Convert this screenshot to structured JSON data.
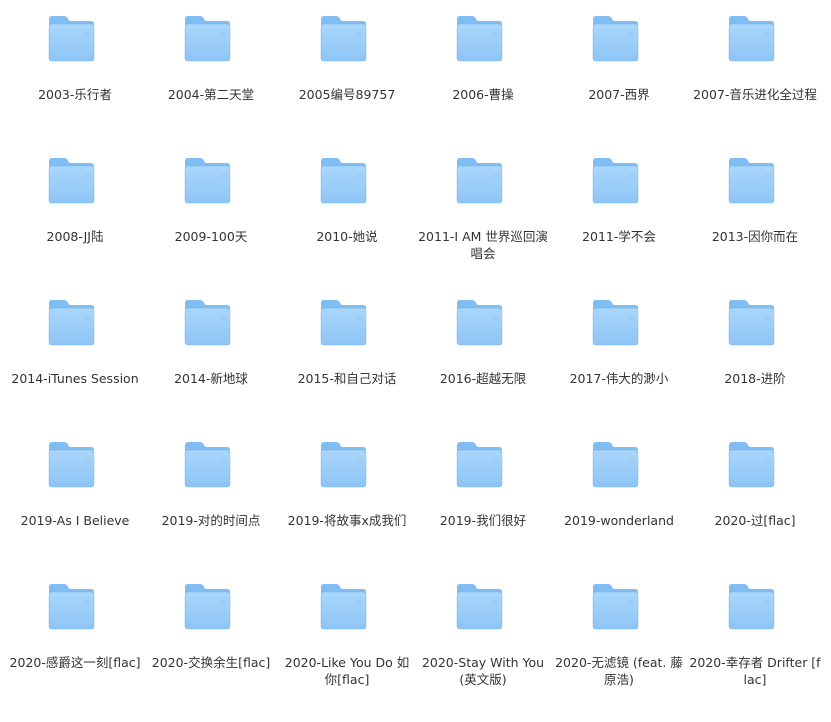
{
  "colors": {
    "folder_back": "#7fbdf3",
    "folder_front_top": "#a9d6fb",
    "folder_front_bottom": "#8ec5f6",
    "folder_edge": "#6aaee8",
    "label_text": "#333333"
  },
  "folder_icon": "folder-icon",
  "folders": [
    {
      "name": "2003-乐行者"
    },
    {
      "name": "2004-第二天堂"
    },
    {
      "name": "2005编号89757"
    },
    {
      "name": "2006-曹操"
    },
    {
      "name": "2007-西界"
    },
    {
      "name": "2007-音乐进化全过程"
    },
    {
      "name": "2008-JJ陆"
    },
    {
      "name": "2009-100天"
    },
    {
      "name": "2010-她说"
    },
    {
      "name": "2011-I AM 世界巡回演唱会"
    },
    {
      "name": "2011-学不会"
    },
    {
      "name": "2013-因你而在"
    },
    {
      "name": "2014-iTunes Session"
    },
    {
      "name": "2014-新地球"
    },
    {
      "name": "2015-和自己对话"
    },
    {
      "name": "2016-超越无限"
    },
    {
      "name": "2017-伟大的渺小"
    },
    {
      "name": "2018-进阶"
    },
    {
      "name": "2019-As I Believe"
    },
    {
      "name": "2019-对的时间点"
    },
    {
      "name": "2019-将故事x成我们"
    },
    {
      "name": "2019-我们很好"
    },
    {
      "name": "2019-wonderland"
    },
    {
      "name": "2020-过[flac]"
    },
    {
      "name": "2020-感爵这一刻[flac]"
    },
    {
      "name": "2020-交换余生[flac]"
    },
    {
      "name": "2020-Like You Do 如你[flac]"
    },
    {
      "name": "2020-Stay With You (英文版)"
    },
    {
      "name": "2020-无滤镜 (feat. 藤原浩)"
    },
    {
      "name": "2020-幸存者 Drifter [flac]"
    }
  ]
}
